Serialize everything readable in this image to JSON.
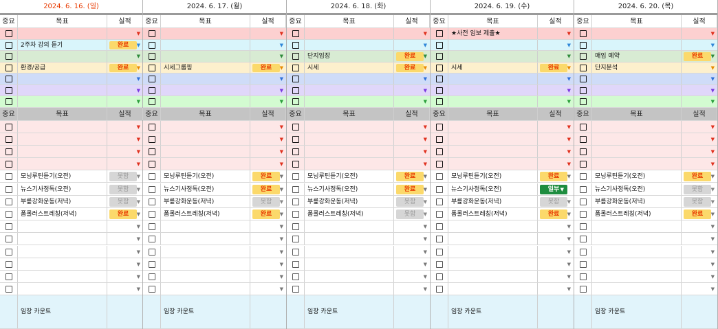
{
  "days": [
    {
      "date": "2024. 6. 16. (일)",
      "highlight": true,
      "top_goals": [
        "",
        "2주차 강의 듣기",
        "",
        "환경/공급",
        "",
        "",
        ""
      ],
      "top_status": [
        "",
        "완료",
        "",
        "완료",
        "",
        "",
        ""
      ],
      "bottom_goals": [
        "",
        "",
        "",
        "",
        "모닝루틴듣기(오전)",
        "뉴스기사정독(오전)",
        "부릎강화운동(저녁)",
        "폼롤러스트레칭(저녁)",
        "",
        "",
        "",
        "",
        "",
        ""
      ],
      "bottom_status": [
        "",
        "",
        "",
        "",
        "못함",
        "못함",
        "못함",
        "완료",
        "",
        "",
        "",
        "",
        "",
        ""
      ],
      "footer": "임장 카운트"
    },
    {
      "date": "2024. 6. 17. (월)",
      "highlight": false,
      "top_goals": [
        "",
        "",
        "",
        "시세그룹핑",
        "",
        "",
        ""
      ],
      "top_status": [
        "",
        "",
        "",
        "완료",
        "",
        "",
        ""
      ],
      "bottom_goals": [
        "",
        "",
        "",
        "",
        "모닝루틴듣기(오전)",
        "뉴스기사정독(오전)",
        "부릎강화운동(저녁)",
        "폼롤러스트레칭(저녁)",
        "",
        "",
        "",
        "",
        "",
        ""
      ],
      "bottom_status": [
        "",
        "",
        "",
        "",
        "완료",
        "완료",
        "못함",
        "완료",
        "",
        "",
        "",
        "",
        "",
        ""
      ],
      "footer": "임장 카운트"
    },
    {
      "date": "2024. 6. 18. (화)",
      "highlight": false,
      "top_goals": [
        "",
        "",
        "단지임장",
        "시세",
        "",
        "",
        ""
      ],
      "top_status": [
        "",
        "",
        "완료",
        "완료",
        "",
        "",
        ""
      ],
      "bottom_goals": [
        "",
        "",
        "",
        "",
        "모닝루틴듣기(오전)",
        "뉴스기사정독(오전)",
        "부릎강화운동(저녁)",
        "폼롤러스트레칭(저녁)",
        "",
        "",
        "",
        "",
        "",
        ""
      ],
      "bottom_status": [
        "",
        "",
        "",
        "",
        "완료",
        "완료",
        "못함",
        "못함",
        "",
        "",
        "",
        "",
        "",
        ""
      ],
      "footer": "임장 카운트"
    },
    {
      "date": "2024. 6. 19. (수)",
      "highlight": false,
      "top_goals": [
        "★사전 임보 제출★",
        "",
        "",
        "시세",
        "",
        "",
        ""
      ],
      "top_status": [
        "",
        "",
        "",
        "완료",
        "",
        "",
        ""
      ],
      "bottom_goals": [
        "",
        "",
        "",
        "",
        "모닝루틴듣기(오전)",
        "뉴스기사정독(오전)",
        "부릎강화운동(저녁)",
        "폼롤러스트레칭(저녁)",
        "",
        "",
        "",
        "",
        "",
        ""
      ],
      "bottom_status": [
        "",
        "",
        "",
        "",
        "완료",
        "일부",
        "못함",
        "완료",
        "",
        "",
        "",
        "",
        "",
        ""
      ],
      "footer": "임장 카운트"
    },
    {
      "date": "2024. 6. 20. (목)",
      "highlight": false,
      "top_goals": [
        "",
        "",
        "매임 예약",
        "단지분석",
        "",
        "",
        ""
      ],
      "top_status": [
        "",
        "",
        "완료",
        "",
        "",
        "",
        ""
      ],
      "bottom_goals": [
        "",
        "",
        "",
        "",
        "모닝루틴듣기(오전)",
        "뉴스기사정독(오전)",
        "부릎강화운동(저녁)",
        "폼롤러스트레칭(저녁)",
        "",
        "",
        "",
        "",
        "",
        ""
      ],
      "bottom_status": [
        "",
        "",
        "",
        "",
        "완료",
        "못함",
        "못함",
        "완료",
        "",
        "",
        "",
        "",
        "",
        ""
      ],
      "footer": "임장 카운트"
    }
  ],
  "headers": {
    "importance": "중요",
    "goal": "목표",
    "result": "실적"
  },
  "top_row_colors": [
    "#fcd0d0",
    "#d9f5fb",
    "#d8ebd3",
    "#fdf0cd",
    "#cfdcf8",
    "#e0d7fa",
    "#d3fbd1"
  ],
  "bottom_row_colors": [
    "#fde7e7",
    "#fde7e7",
    "#fde7e7",
    "#fde7e7",
    "#ffffff",
    "#ffffff",
    "#ffffff",
    "#ffffff",
    "#ffffff",
    "#ffffff",
    "#ffffff",
    "#ffffff",
    "#ffffff",
    "#ffffff"
  ],
  "arrow_colors_top": [
    "#e0301e",
    "#2e86d8",
    "#2d8a3a",
    "#e88a00",
    "#2e6fd8",
    "#7a3ae0",
    "#2aa03a"
  ],
  "arrow_colors_bottom": [
    "#e0301e",
    "#e0301e",
    "#e0301e",
    "#e0301e",
    "#777777",
    "#777777",
    "#777777",
    "#777777",
    "#777777",
    "#777777",
    "#777777",
    "#777777",
    "#777777",
    "#777777"
  ],
  "status_colors": {
    "완료": "b-done",
    "일부": "b-part",
    "못함": "b-miss"
  },
  "colors": {
    "highlight_date": "#e83a00",
    "header_gray": "#c4c4c4",
    "footer_blue": "#e1f4fb"
  },
  "icons": {
    "dropdown": "dropdown-arrow-icon",
    "checkbox": "checkbox-icon"
  }
}
